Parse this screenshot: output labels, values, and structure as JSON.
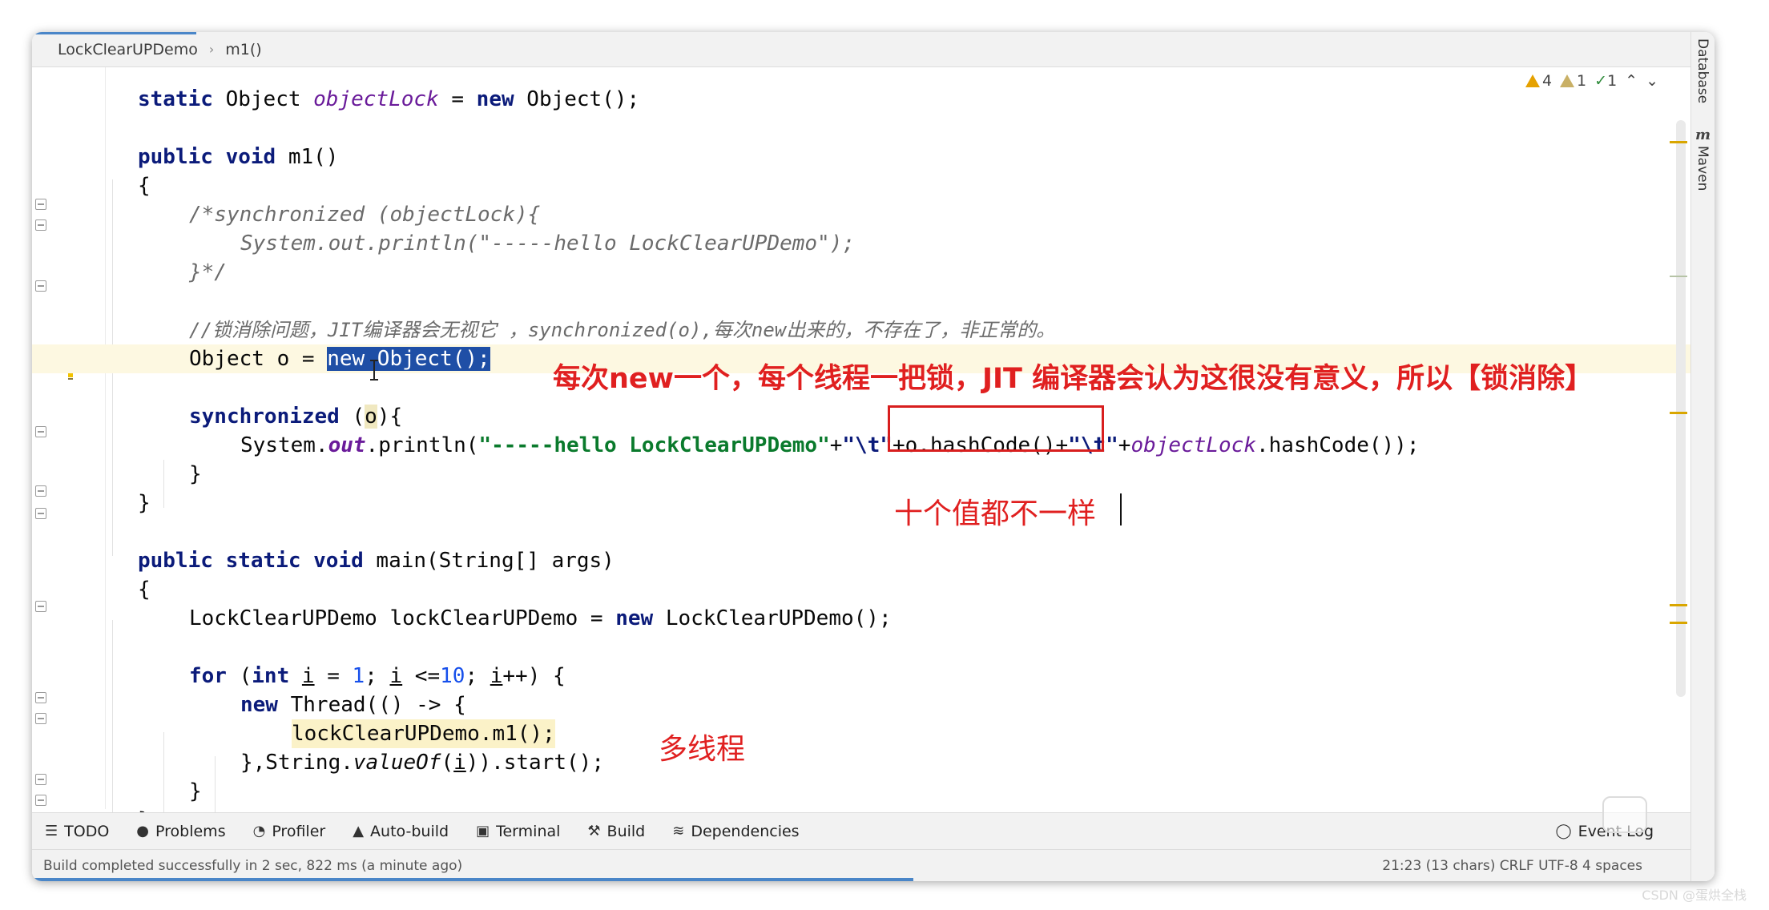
{
  "breadcrumb": {
    "class_name": "LockClearUPDemo",
    "method": "m1()"
  },
  "right_panel": {
    "database": "Database",
    "maven_icon": "m",
    "maven": "Maven"
  },
  "inspections": {
    "warnings": "4",
    "weak_warnings": "1",
    "typos": "1"
  },
  "code": {
    "l1_kw": "static",
    "l1_type": "Object",
    "l1_field": "objectLock",
    "l1_eq": " = ",
    "l1_new": "new",
    "l1_rest": " Object();",
    "l3_kw": "public void",
    "l3_rest": " m1()",
    "l4": "{",
    "l5": "/*synchronized (objectLock){",
    "l6": "System.out.println(\"-----hello LockClearUPDemo\");",
    "l7": "}*/",
    "l9": "//锁消除问题，JIT编译器会无视它 ，synchronized(o),每次new出来的，不存在了，非正常的。",
    "l10_a": "Object o = ",
    "l10_new": "new",
    "l10_sel": " Object();",
    "l12_kw": "synchronized",
    "l12_a": " (",
    "l12_o": "o",
    "l12_b": "){",
    "l13_a": "System.",
    "l13_out": "out",
    "l13_b": ".println(",
    "l13_str": "\"-----hello LockClearUPDemo\"",
    "l13_c": "+",
    "l13_esc1": "\"\\t\"",
    "l13_d": "+o.hashCode()+",
    "l13_esc2": "\"\\t\"",
    "l13_e": "+",
    "l13_field": "objectLock",
    "l13_f": ".hashCode());",
    "l14": "}",
    "l15": "}",
    "l17_kw": "public static void",
    "l17_rest": " main(String[] args)",
    "l18": "{",
    "l19_a": "LockClearUPDemo lockClearUPDemo = ",
    "l19_new": "new",
    "l19_b": " LockClearUPDemo();",
    "l21_for": "for",
    "l21_a": " (",
    "l21_int": "int",
    "l21_sp": " ",
    "l21_i1": "i",
    "l21_b": " = ",
    "l21_n1": "1",
    "l21_c": "; ",
    "l21_i2": "i",
    "l21_d": " <=",
    "l21_n2": "10",
    "l21_e": "; ",
    "l21_i3": "i",
    "l21_f": "++) {",
    "l22_new": "new",
    "l22_a": " Thread(() -> {",
    "l23": "lockClearUPDemo.m1();",
    "l24_a": "},String.",
    "l24_valueof": "valueOf",
    "l24_b": "(",
    "l24_i": "i",
    "l24_c": ")).start();",
    "l25": "}",
    "l26": "}",
    "l27": "}"
  },
  "annotations": {
    "lock_clear": "每次new一个，每个线程一把锁，JIT 编译器会认为这很没有意义，所以【锁消除】",
    "values_differ": "十个值都不一样",
    "multi_thread": "多线程",
    "color": "#e02020"
  },
  "toolbar": {
    "todo": "TODO",
    "problems": "Problems",
    "profiler": "Profiler",
    "autobuild": "Auto-build",
    "terminal": "Terminal",
    "build": "Build",
    "dependencies": "Dependencies",
    "event_log": "Event Log"
  },
  "status": {
    "message": "Build completed successfully in 2 sec, 822 ms (a minute ago)",
    "position": "21:23 (13 chars)   CRLF   UTF-8   4 spaces"
  },
  "watermark": "CSDN @蛋烘全栈"
}
